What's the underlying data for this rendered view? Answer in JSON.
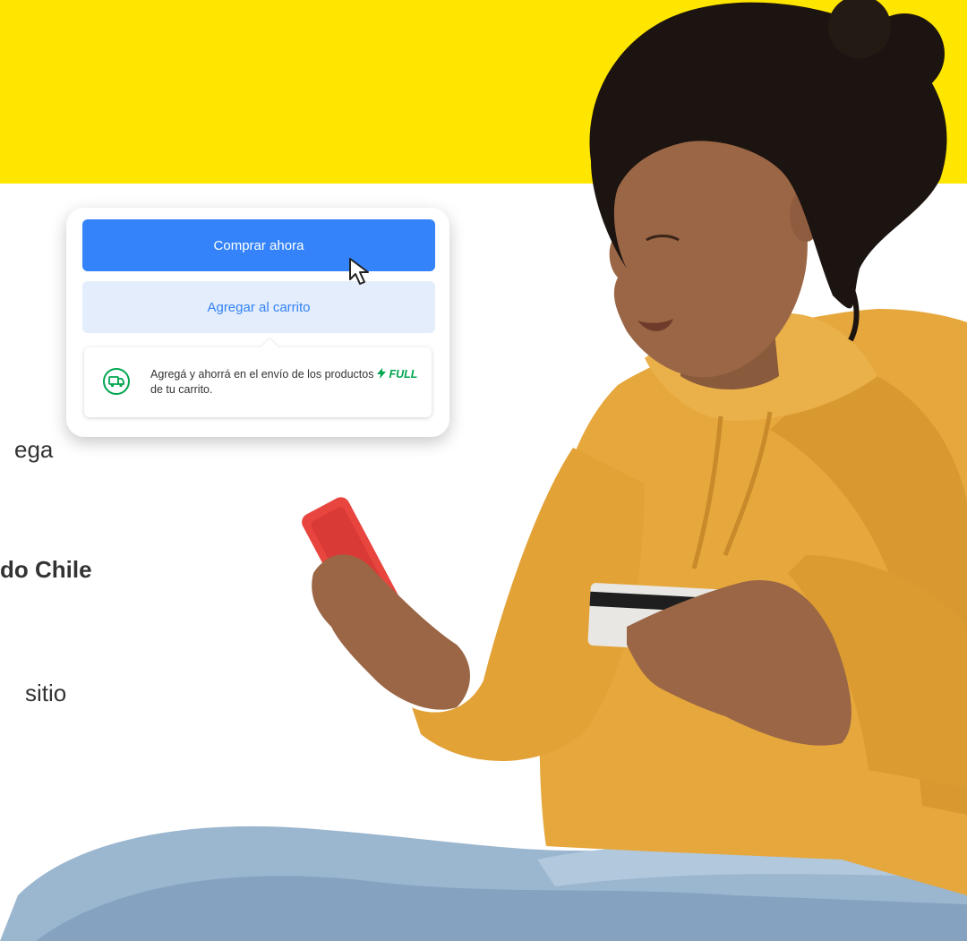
{
  "colors": {
    "yellow": "#ffe600",
    "primary_blue": "#3483fa",
    "secondary_bg": "#e3edfb",
    "secondary_text": "#3483fa",
    "full_green": "#00a650"
  },
  "background_text": {
    "line1": "ega",
    "line2": "do Chile",
    "line3": "sitio"
  },
  "card": {
    "buy_now_label": "Comprar ahora",
    "add_to_cart_label": "Agregar al carrito",
    "notice": {
      "text_before": "Agregá y ahorrá en el envío de los productos",
      "full_label": "FULL",
      "text_after": "de tu carrito.",
      "icon": "truck-icon"
    }
  },
  "icons": {
    "cursor": "mouse-pointer-icon",
    "bolt": "lightning-bolt-icon"
  }
}
